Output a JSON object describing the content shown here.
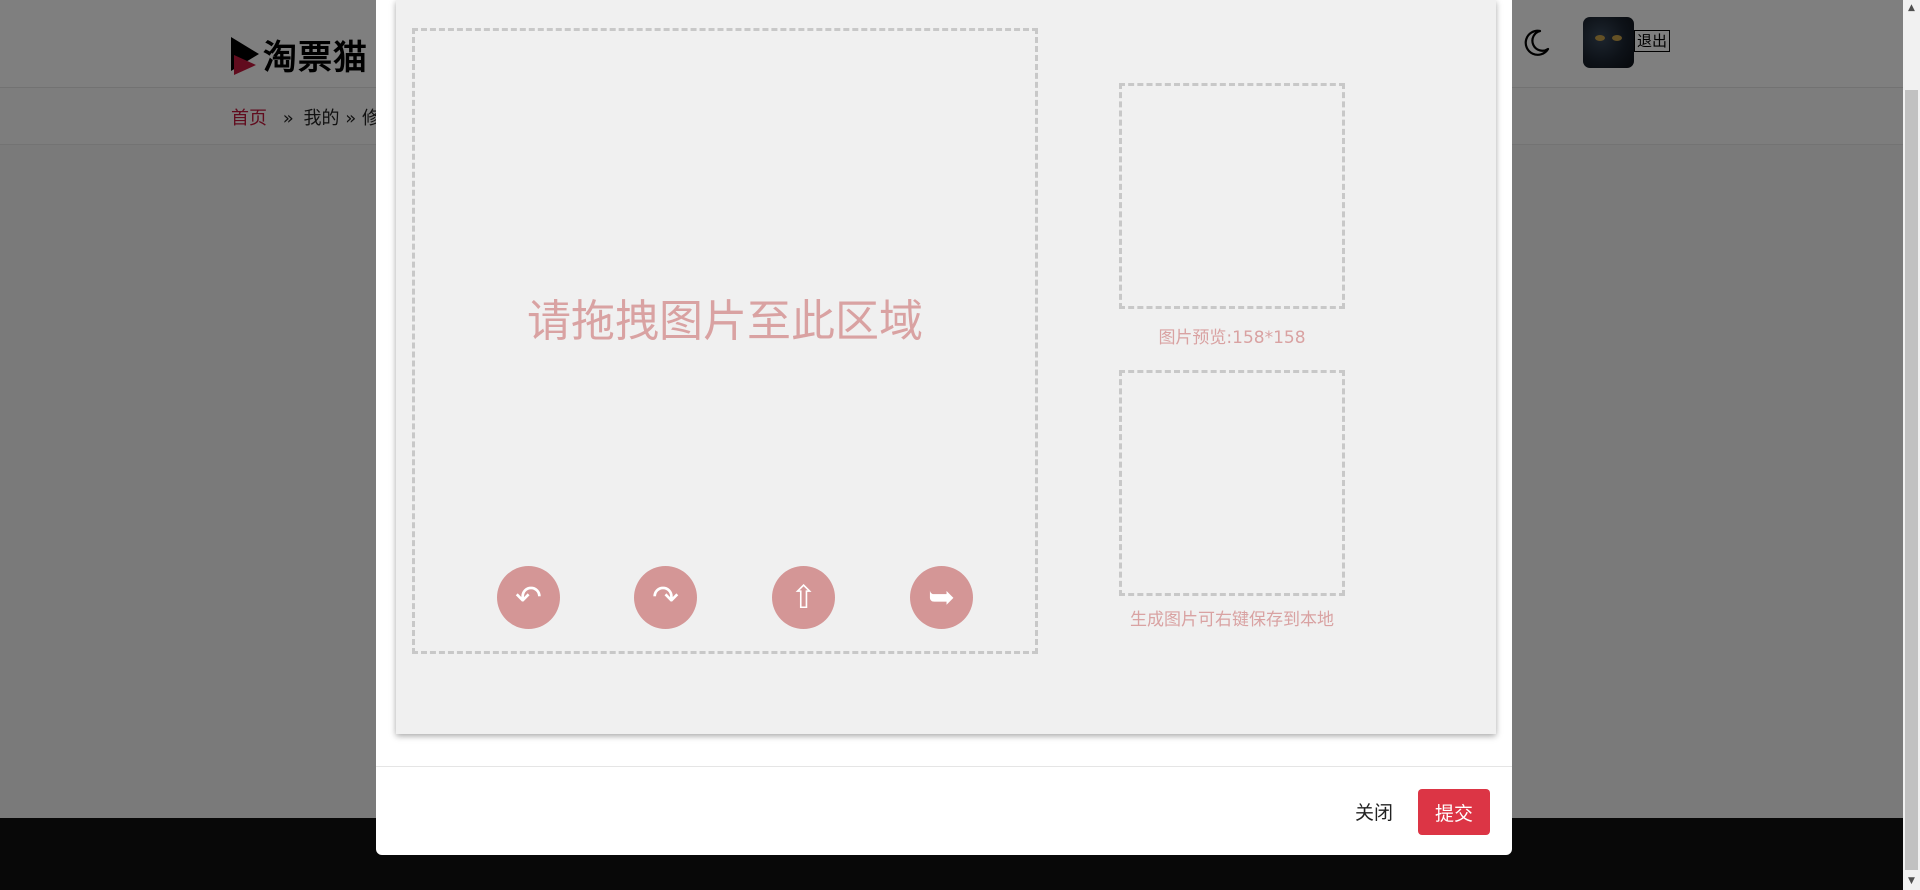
{
  "header": {
    "logo_text": "淘票猫",
    "logout_label": "退出"
  },
  "breadcrumb": {
    "home": "首页",
    "sep1": "»",
    "mine": "我的",
    "sep2": "»",
    "current": "修改"
  },
  "modal": {
    "drop_hint": "请拖拽图片至此区域",
    "controls": {
      "rotate_left_icon": "↶",
      "rotate_right_icon": "↷",
      "upload_icon": "⇧",
      "export_icon": "➥"
    },
    "preview_caption": "图片预览:158*158",
    "result_caption": "生成图片可右键保存到本地",
    "close_label": "关闭",
    "submit_label": "提交"
  },
  "scrollbar": {
    "up_icon": "▲",
    "down_icon": "▼"
  },
  "colors": {
    "brand_red": "#c3183c",
    "submit_red": "#dc3545",
    "control_pink": "#d49696",
    "hint_pink": "#d9a2a2"
  }
}
